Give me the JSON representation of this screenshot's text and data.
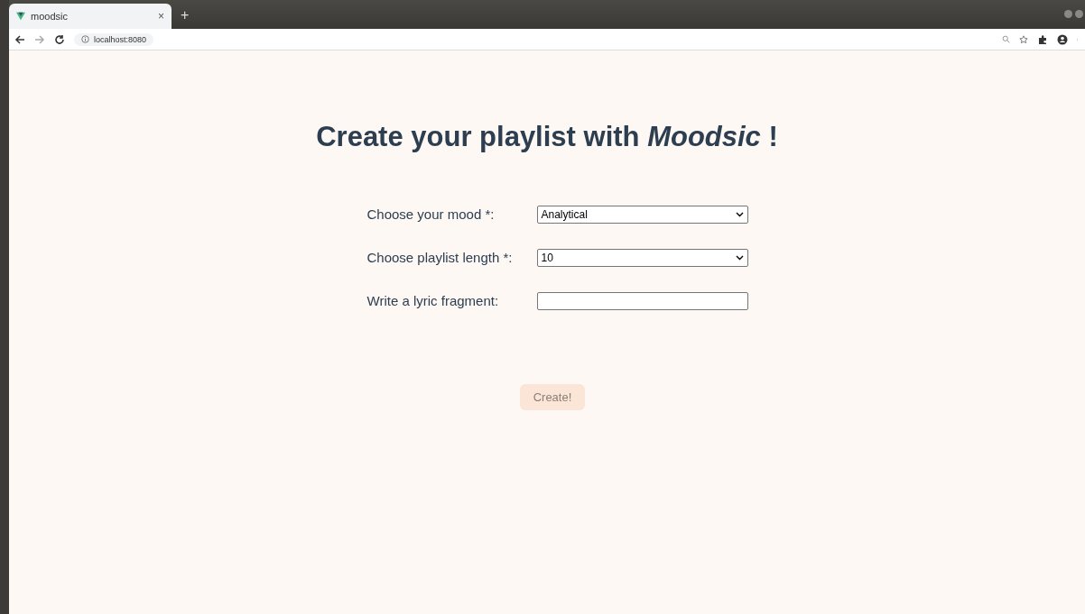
{
  "browser": {
    "tab_title": "moodsic",
    "tab_close": "×",
    "new_tab": "+",
    "url": "localhost:8080"
  },
  "page": {
    "title": "Create your playlist with *Moodsic* !",
    "fields": [
      {
        "kind": "select",
        "label": "Choose your mood *:",
        "value": "Analytical"
      },
      {
        "kind": "select",
        "label": "Choose playlist length *:",
        "value": "10"
      },
      {
        "kind": "text",
        "label": "Write a lyric fragment:"
      }
    ],
    "button": {
      "label": "Create!",
      "disabled": true
    }
  }
}
